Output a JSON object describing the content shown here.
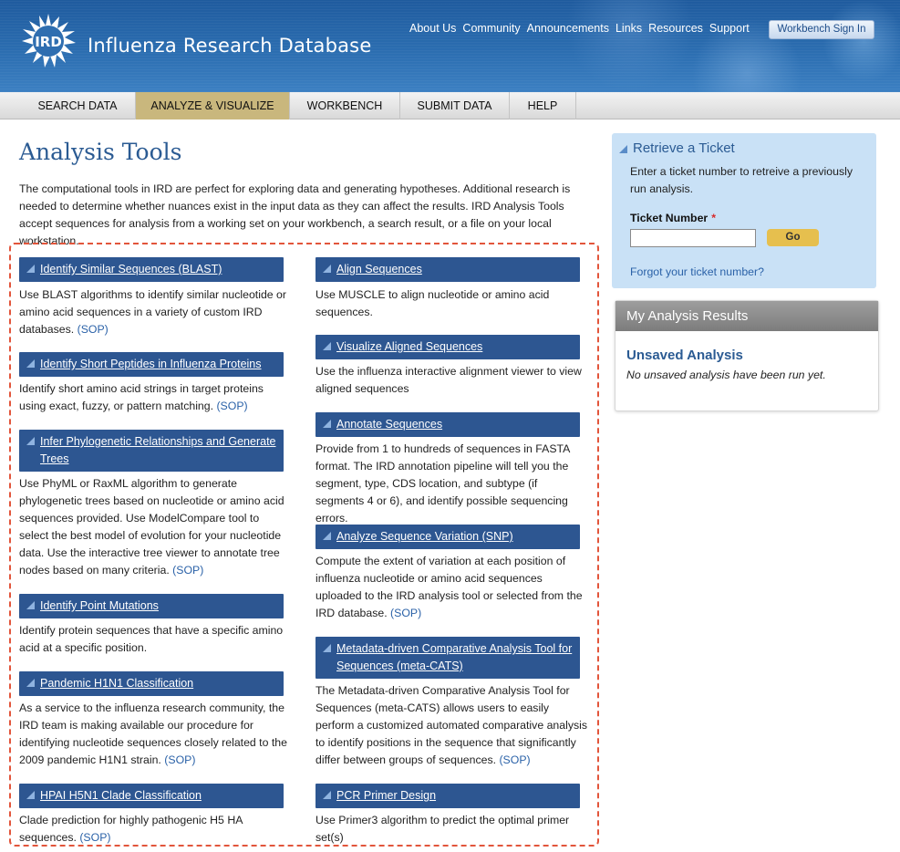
{
  "header": {
    "logo_text": "Influenza Research Database",
    "logo_badge": "IRD",
    "top_links": [
      "About Us",
      "Community",
      "Announcements",
      "Links",
      "Resources",
      "Support"
    ],
    "signin_label": "Workbench Sign In"
  },
  "nav": {
    "items": [
      "SEARCH DATA",
      "ANALYZE & VISUALIZE",
      "WORKBENCH",
      "SUBMIT DATA",
      "HELP"
    ],
    "active_index": 1
  },
  "main": {
    "title": "Analysis Tools",
    "intro": "The computational tools in IRD are perfect for exploring data and generating hypotheses. Additional research is needed to determine whether nuances exist in the input data as they can affect the results. IRD Analysis Tools accept sequences for analysis from a working set on your workbench, a search result, or a file on your local workstation."
  },
  "tools": {
    "sop_label": "(SOP)",
    "left": [
      {
        "title": "Identify Similar Sequences (BLAST)",
        "desc": "Use BLAST algorithms to identify similar nucleotide or amino acid sequences in a variety of custom IRD databases.",
        "sop": true
      },
      {
        "title": "Identify Short Peptides in Influenza Proteins",
        "desc": "Identify short amino acid strings in target proteins using exact, fuzzy, or pattern matching.",
        "sop": true
      },
      {
        "title": "Infer Phylogenetic Relationships and Generate Trees",
        "desc": "Use PhyML or RaxML algorithm to generate phylogenetic trees based on nucleotide or amino acid sequences provided. Use ModelCompare tool to select the best model of evolution for your nucleotide data. Use the interactive tree viewer to annotate tree nodes based on many criteria.",
        "sop": true
      },
      {
        "title": "Identify Point Mutations",
        "desc": "Identify protein sequences that have a specific amino acid at a specific position.",
        "sop": false
      },
      {
        "title": "Pandemic H1N1 Classification",
        "desc": "As a service to the influenza research community, the IRD team is making available our procedure for identifying nucleotide sequences closely related to the 2009 pandemic H1N1 strain.",
        "sop": true
      },
      {
        "title": "HPAI H5N1 Clade Classification",
        "desc": "Clade prediction for highly pathogenic H5 HA sequences.",
        "sop": true
      }
    ],
    "right": [
      {
        "title": "Align Sequences",
        "desc": "Use MUSCLE to align nucleotide or amino acid sequences.",
        "sop": false
      },
      {
        "title": "Visualize Aligned Sequences",
        "desc": "Use the influenza interactive alignment viewer to view aligned sequences",
        "sop": false
      },
      {
        "title": "Annotate Sequences",
        "desc": "Provide from 1 to hundreds of sequences in FASTA format. The IRD annotation pipeline will tell you the segment, type, CDS location, and subtype (if segments 4 or 6), and identify possible sequencing errors.",
        "sop": false
      },
      {
        "title": "Analyze Sequence Variation (SNP)",
        "desc": "Compute the extent of variation at each position of influenza nucleotide or amino acid sequences uploaded to the IRD analysis tool or selected from the IRD database.",
        "sop": true
      },
      {
        "title": "Metadata-driven Comparative Analysis Tool for Sequences (meta-CATS)",
        "desc": "The Metadata-driven Comparative Analysis Tool for Sequences (meta-CATS) allows users to easily perform a customized automated comparative analysis to identify positions in the sequence that significantly differ between groups of sequences.",
        "sop": true
      },
      {
        "title": "PCR Primer Design",
        "desc": "Use Primer3 algorithm to predict the optimal primer set(s)",
        "sop": false
      }
    ]
  },
  "ticket": {
    "title": "Retrieve a Ticket",
    "desc": "Enter a ticket number to retreive a previously run analysis.",
    "label": "Ticket Number",
    "required_mark": "*",
    "input_value": "",
    "go_label": "Go",
    "forgot_link": "Forgot your ticket number?"
  },
  "results": {
    "header": "My Analysis Results",
    "unsaved_title": "Unsaved Analysis",
    "unsaved_desc": "No unsaved analysis have been run yet."
  },
  "colors": {
    "header_blue": "#2b6db0",
    "tool_bar_blue": "#2d5691",
    "nav_active": "#c9b77d",
    "ticket_bg": "#c9e1f6",
    "highlight_red": "#e2553b",
    "link_blue": "#2b62a8"
  }
}
